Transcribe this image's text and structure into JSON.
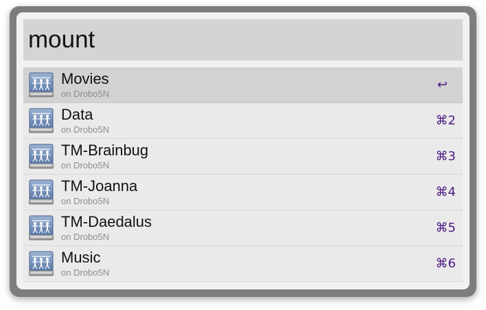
{
  "search": {
    "query": "mount"
  },
  "results": [
    {
      "title": "Movies",
      "subtitle": "on Drobo5N",
      "shortcut": "↩",
      "icon": "network-drive-icon",
      "selected": true
    },
    {
      "title": "Data",
      "subtitle": "on Drobo5N",
      "shortcut": "⌘2",
      "icon": "network-drive-icon"
    },
    {
      "title": "TM-Brainbug",
      "subtitle": "on Drobo5N",
      "shortcut": "⌘3",
      "icon": "network-drive-icon"
    },
    {
      "title": "TM-Joanna",
      "subtitle": "on Drobo5N",
      "shortcut": "⌘4",
      "icon": "network-drive-icon"
    },
    {
      "title": "TM-Daedalus",
      "subtitle": "on Drobo5N",
      "shortcut": "⌘5",
      "icon": "network-drive-icon"
    },
    {
      "title": "Music",
      "subtitle": "on Drobo5N",
      "shortcut": "⌘6",
      "icon": "network-drive-icon"
    }
  ],
  "colors": {
    "shortcut_text": "#4b1a82",
    "selected_row": "#d2d2d2",
    "query_field": "#d4d4d4",
    "window_frame": "#7d7d7d"
  }
}
